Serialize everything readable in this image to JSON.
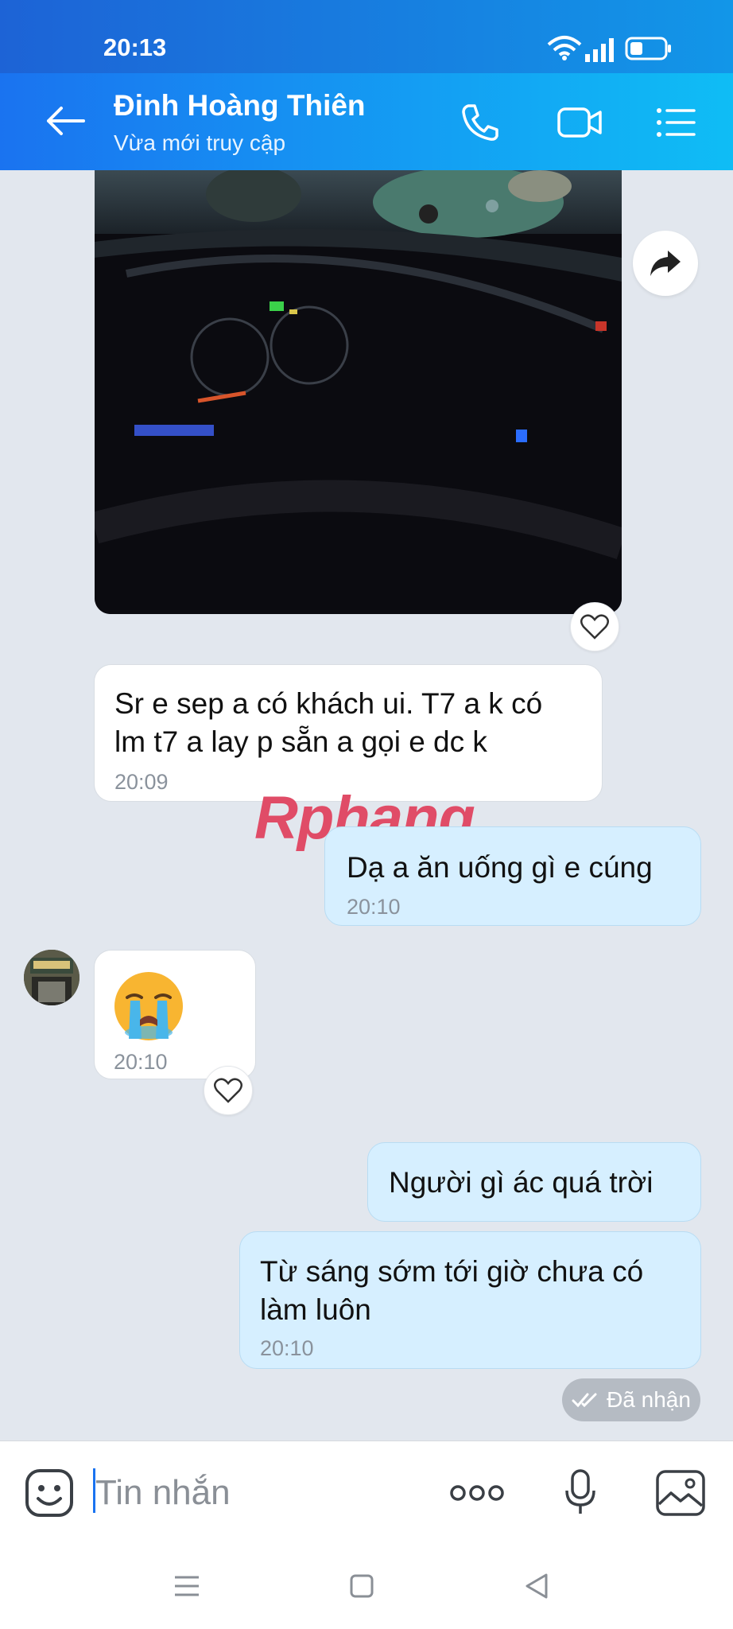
{
  "status": {
    "time": "20:13"
  },
  "header": {
    "name": "Đinh Hoàng Thiên",
    "status": "Vừa mới truy cập"
  },
  "messages": {
    "m1": {
      "text1": "Sr e sep a có khách ui. T7 a k có",
      "text2": "lm t7 a lay p sẵn a gọi e dc k",
      "time": "20:09"
    },
    "m2": {
      "text": "Dạ a ăn uống gì e cúng",
      "time": "20:10"
    },
    "m3": {
      "time": "20:10"
    },
    "m4": {
      "text": "Người gì ác quá trời"
    },
    "m5": {
      "text1": "Từ sáng sớm tới giờ chưa có",
      "text2": "làm luôn",
      "time": "20:10"
    },
    "received": "Đã nhận"
  },
  "watermark": "Rphang",
  "input": {
    "placeholder": "Tin nhắn"
  },
  "colors": {
    "header_start": "#1a73f0",
    "header_end": "#0fbdf5",
    "outgoing": "#d6efff",
    "incoming": "#ffffff"
  }
}
